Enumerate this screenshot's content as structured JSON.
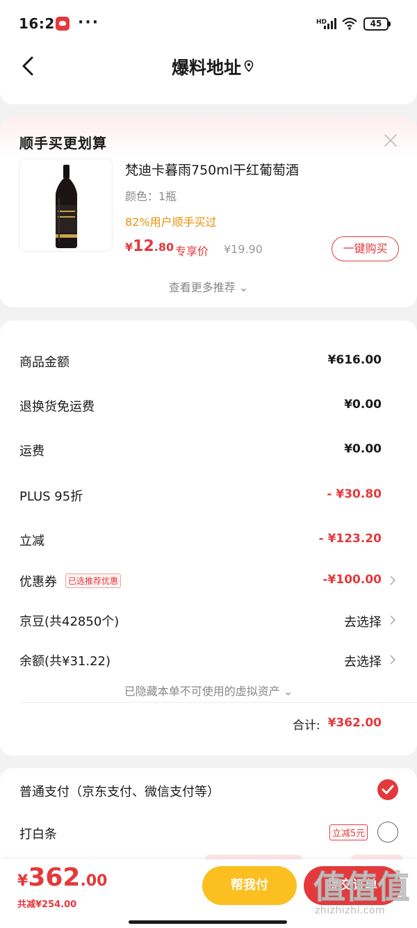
{
  "status_bar": {
    "time": "16:21",
    "more": "···",
    "network": "HD",
    "battery": "45"
  },
  "header": {
    "title": "爆料地址"
  },
  "recommendation": {
    "title": "顺手买更划算",
    "product": {
      "name": "梵迪卡暮雨750ml干红葡萄酒",
      "spec": "颜色：1瓶",
      "buyers": "82%用户顺手买过",
      "price_symbol": "¥",
      "price_int": "12",
      "price_dec": ".80",
      "price_tag": "专享价",
      "original_price": "¥19.90",
      "buy_label": "一键购买"
    },
    "more_label": "查看更多推荐 ⌄"
  },
  "summary": {
    "rows": [
      {
        "label": "商品金额",
        "value": "¥616.00"
      },
      {
        "label": "退换货免运费",
        "value": "¥0.00"
      },
      {
        "label": "运费",
        "value": "¥0.00"
      },
      {
        "label": "PLUS 95折",
        "value": "- ¥30.80"
      },
      {
        "label": "立减",
        "value": "- ¥123.20"
      },
      {
        "label": "优惠券",
        "tag": "已选推荐优惠",
        "value": "-¥100.00"
      },
      {
        "label": "京豆(共42850个)",
        "value": "去选择"
      },
      {
        "label": "余额(共¥31.22)",
        "value": "去选择"
      }
    ],
    "hidden_note": "已隐藏本单不可使用的虚拟资产 ⌄",
    "total_label": "合计:",
    "total_value": "¥362.00"
  },
  "payment": {
    "option1": "普通支付（京东支付、微信支付等）",
    "option2": "打白条",
    "option2_tag": "立减5元"
  },
  "bottom_bar": {
    "price_symbol": "¥",
    "price_int": "362",
    "price_dec": ".00",
    "saved": "共减¥254.00",
    "help_pay": "帮我付",
    "submit": "提交订单"
  },
  "watermark": {
    "logo_text": "值值值",
    "url": "zhizhizhi.com"
  },
  "colors": {
    "accent_red": "#e4393c",
    "help_yellow": "#fbbf1f",
    "buyers_orange": "#e6920e"
  }
}
